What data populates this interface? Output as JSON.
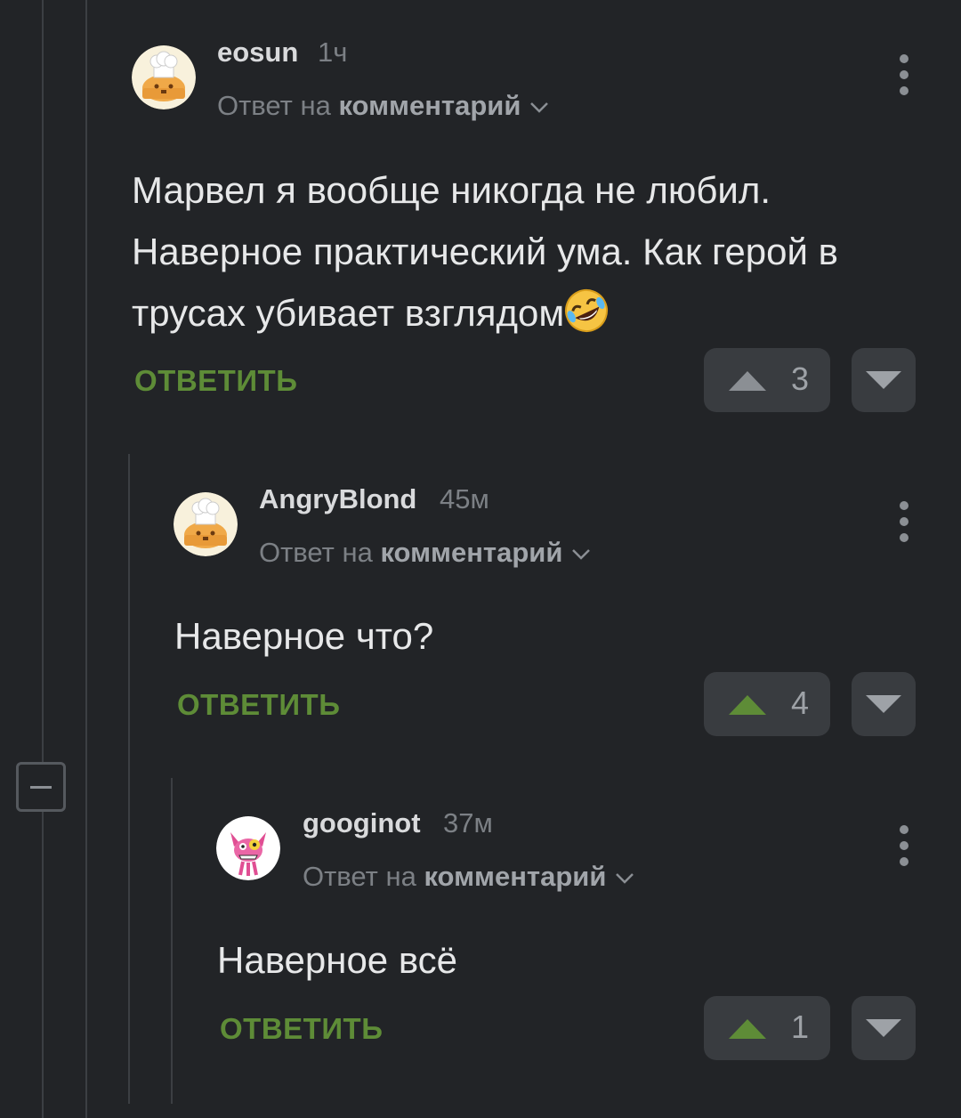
{
  "reply_action_label": "ОТВЕТИТЬ",
  "reply_prefix": "Ответ на",
  "reply_link": "комментарий",
  "comments": [
    {
      "author": "eosun",
      "time": "1ч",
      "text": "Марвел я вообще никогда не любил. Наверное практический ума. Как герой в трусах убивает взглядом",
      "emoji": "rolling-on-floor-laughing",
      "rating": "3",
      "upvote_color": "#8b8f94"
    },
    {
      "author": "AngryBlond",
      "time": "45м",
      "text": "Наверное что?",
      "rating": "4",
      "upvote_color": "#5e8c37"
    },
    {
      "author": "googinot",
      "time": "37м",
      "text": "Наверное всё",
      "rating": "1",
      "upvote_color": "#5e8c37"
    }
  ]
}
